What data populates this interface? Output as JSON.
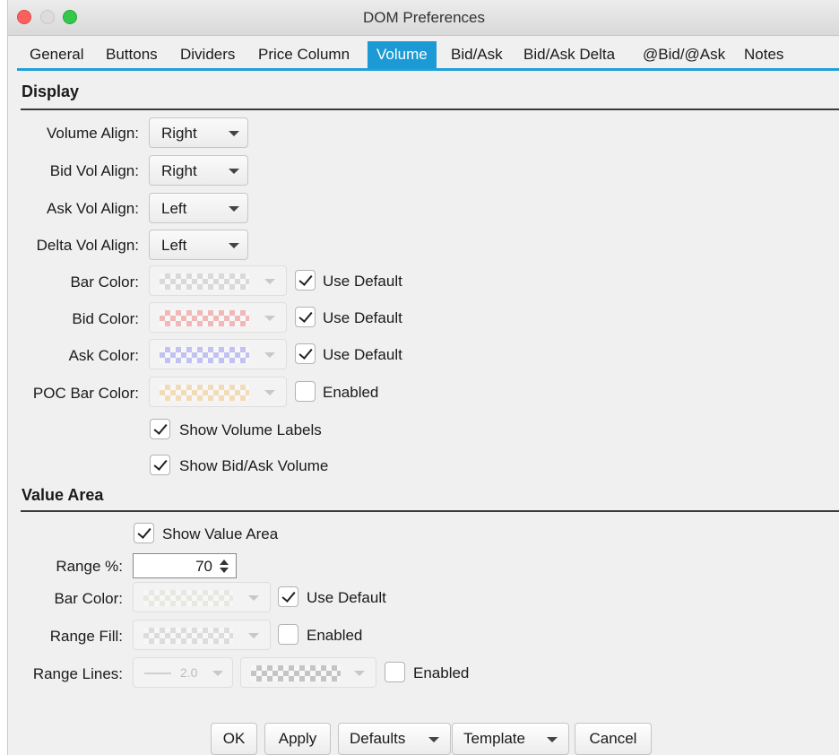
{
  "window": {
    "title": "DOM Preferences"
  },
  "tabs": [
    "General",
    "Buttons",
    "Dividers",
    "Price Column",
    "Volume",
    "Bid/Ask",
    "Bid/Ask Delta",
    "@Bid/@Ask",
    "Notes"
  ],
  "active_tab": "Volume",
  "display": {
    "title": "Display",
    "volume_align": {
      "label": "Volume Align:",
      "value": "Right"
    },
    "bid_vol_align": {
      "label": "Bid Vol Align:",
      "value": "Right"
    },
    "ask_vol_align": {
      "label": "Ask Vol Align:",
      "value": "Left"
    },
    "delta_vol_align": {
      "label": "Delta Vol Align:",
      "value": "Left"
    },
    "bar_color": {
      "label": "Bar Color:",
      "checkbox": "Use Default",
      "checked": true,
      "swatch": "#d9d9d9"
    },
    "bid_color": {
      "label": "Bid Color:",
      "checkbox": "Use Default",
      "checked": true,
      "swatch": "#f2b8b8"
    },
    "ask_color": {
      "label": "Ask Color:",
      "checkbox": "Use Default",
      "checked": true,
      "swatch": "#c2c2f2"
    },
    "poc_bar_color": {
      "label": "POC Bar Color:",
      "checkbox": "Enabled",
      "checked": false,
      "swatch": "#f2dcb8"
    },
    "show_volume_labels": {
      "label": "Show Volume Labels",
      "checked": true
    },
    "show_bid_ask_volume": {
      "label": "Show Bid/Ask Volume",
      "checked": true
    }
  },
  "value_area": {
    "title": "Value Area",
    "show_value_area": {
      "label": "Show Value Area",
      "checked": true
    },
    "range_pct": {
      "label": "Range %:",
      "value": "70"
    },
    "bar_color": {
      "label": "Bar Color:",
      "checkbox": "Use Default",
      "checked": true,
      "swatch": "#e8e8e0"
    },
    "range_fill": {
      "label": "Range Fill:",
      "checkbox": "Enabled",
      "checked": false,
      "swatch": "#dcdcdc"
    },
    "range_lines": {
      "label": "Range Lines:",
      "width": "2.0",
      "checkbox": "Enabled",
      "checked": false,
      "swatch": "#c4c4c4"
    }
  },
  "buttons": {
    "ok": "OK",
    "apply": "Apply",
    "defaults": "Defaults",
    "template": "Template",
    "cancel": "Cancel"
  }
}
